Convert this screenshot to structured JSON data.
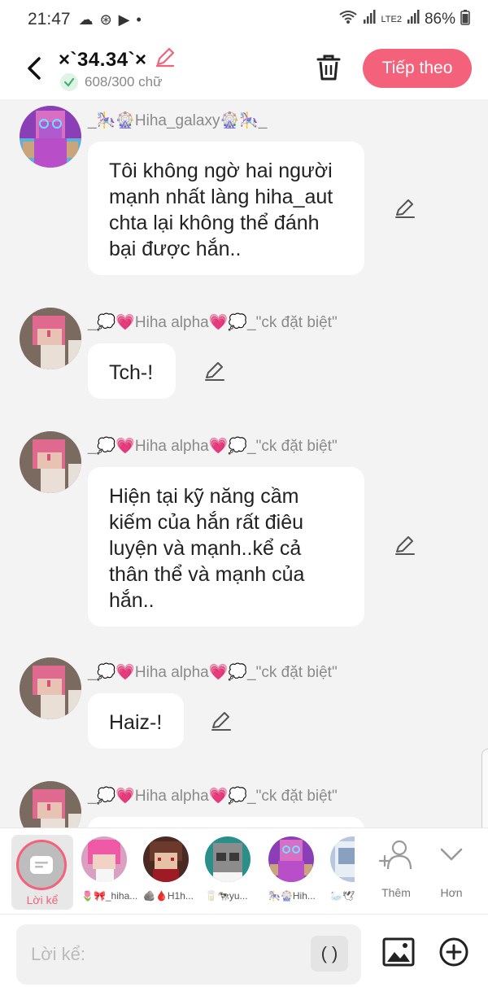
{
  "status": {
    "time": "21:47",
    "battery": "86%",
    "network": "LTE2"
  },
  "header": {
    "title": "×`34.34`×",
    "word_count": "608/300 chữ",
    "next_label": "Tiếp theo"
  },
  "messages": [
    {
      "name": "_🎠🎡Hiha_galaxy🎡🎠_",
      "text": "Tôi không ngờ hai người mạnh nhất làng hiha_aut chta lại không thể đánh bại được hắn.."
    },
    {
      "name": "_💭💗Hiha alpha💗💭_\"ck đặt biệt\"",
      "text": "Tch-!"
    },
    {
      "name": "_💭💗Hiha alpha💗💭_\"ck đặt biệt\"",
      "text": "Hiện tại kỹ năng cầm kiếm của hắn rất điêu luyện và mạnh..kể cả thân thể và mạnh của hắn.."
    },
    {
      "name": "_💭💗Hiha alpha💗💭_\"ck đặt biệt\"",
      "text": "Haiz-!"
    },
    {
      "name": "_💭💗Hiha alpha💗💭_\"ck đặt biệt\"",
      "text": ""
    }
  ],
  "characters": {
    "narrator_label": "Lời kể",
    "items": [
      {
        "label": "🌷🎀_hiha..."
      },
      {
        "label": "🪨🩸H1h..."
      },
      {
        "label": "🥛🐄yu..."
      },
      {
        "label": "🎠🎡Hih..."
      },
      {
        "label": "🦢🕊"
      }
    ],
    "add_label": "Thêm",
    "more_label": "Hơn"
  },
  "input": {
    "placeholder": "Lời kể:",
    "paren_label": "( )"
  },
  "colors": {
    "accent": "#f4617a",
    "background": "#f3f3f3"
  }
}
